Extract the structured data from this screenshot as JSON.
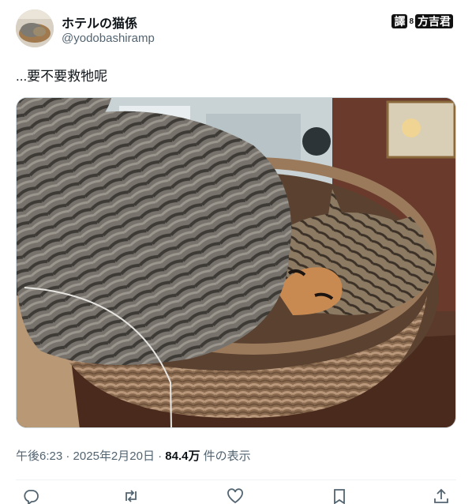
{
  "user": {
    "display_name": "ホテルの猫係",
    "handle": "@yodobashiramp"
  },
  "watermark": {
    "char1": "譯",
    "separator": "8",
    "name": "方吉君"
  },
  "tweet": {
    "text": "...要不要救牠呢"
  },
  "meta": {
    "time": "午後6:23",
    "dot1": "·",
    "date": "2025年2月20日",
    "dot2": "·",
    "views_count": "84.4万",
    "views_label": "件の表示"
  },
  "icons": {
    "reply": "reply-icon",
    "retweet": "retweet-icon",
    "like": "like-icon",
    "bookmark": "bookmark-icon",
    "share": "share-icon"
  },
  "colors": {
    "text_primary": "#0f1419",
    "text_secondary": "#536471",
    "border": "#cfd9de"
  }
}
